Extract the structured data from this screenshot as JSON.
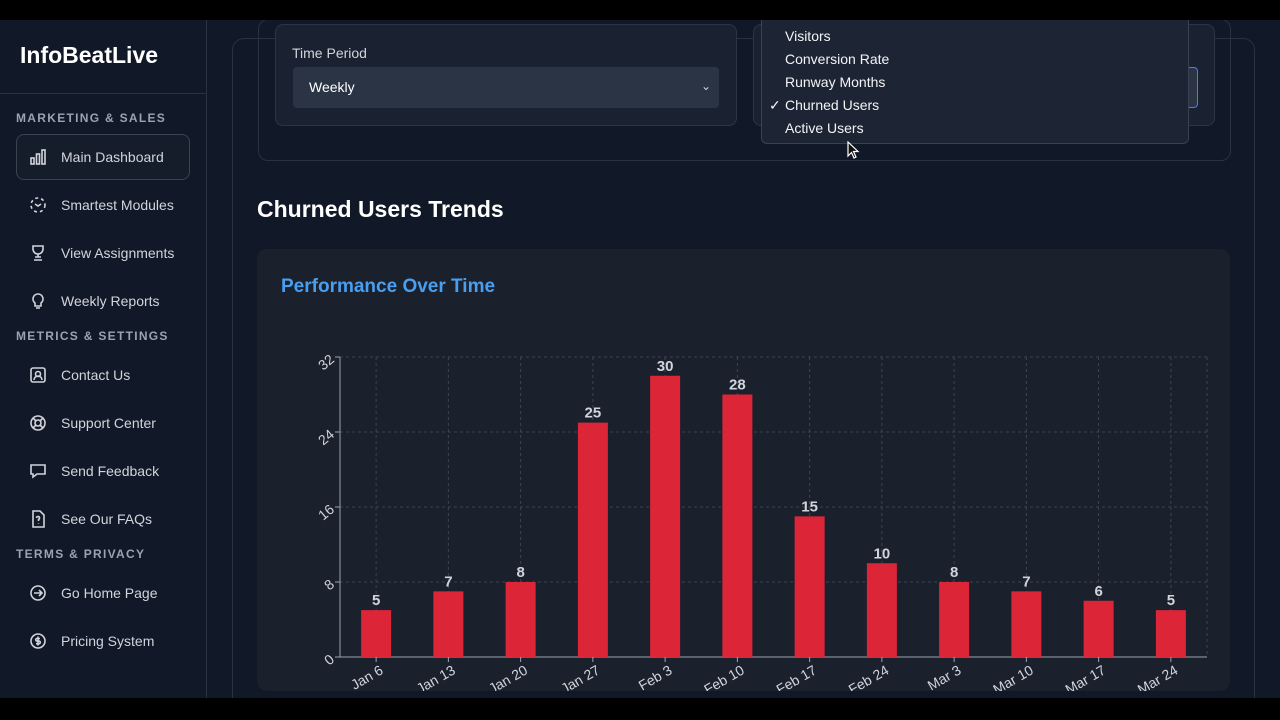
{
  "app": {
    "title": "InfoBeatLive"
  },
  "sidebar": {
    "sections": [
      {
        "title": "MARKETING & SALES",
        "items": [
          {
            "label": "Main Dashboard",
            "icon": "bar-chart-icon",
            "active": true
          },
          {
            "label": "Smartest Modules",
            "icon": "modules-icon"
          },
          {
            "label": "View Assignments",
            "icon": "trophy-icon"
          },
          {
            "label": "Weekly Reports",
            "icon": "lightbulb-icon"
          }
        ]
      },
      {
        "title": "METRICS & SETTINGS",
        "items": [
          {
            "label": "Contact Us",
            "icon": "contact-icon"
          },
          {
            "label": "Support Center",
            "icon": "lifebuoy-icon"
          },
          {
            "label": "Send Feedback",
            "icon": "chat-icon"
          },
          {
            "label": "See Our FAQs",
            "icon": "faq-icon"
          }
        ]
      },
      {
        "title": "TERMS & PRIVACY",
        "items": [
          {
            "label": "Go Home Page",
            "icon": "arrow-circle-icon"
          },
          {
            "label": "Pricing System",
            "icon": "dollar-icon"
          }
        ]
      }
    ]
  },
  "filters": {
    "time_period": {
      "label": "Time Period",
      "value": "Weekly"
    },
    "metric_menu": {
      "options": [
        "Visitors",
        "Conversion Rate",
        "Runway Months",
        "Churned Users",
        "Active Users"
      ],
      "selected": "Churned Users"
    }
  },
  "main": {
    "heading": "Churned Users Trends",
    "chart_title": "Performance Over Time"
  },
  "colors": {
    "bar": "#dc2638",
    "title": "#4a9eef"
  },
  "chart_data": {
    "type": "bar",
    "title": "Performance Over Time",
    "categories": [
      "Jan 6",
      "Jan 13",
      "Jan 20",
      "Jan 27",
      "Feb 3",
      "Feb 10",
      "Feb 17",
      "Feb 24",
      "Mar 3",
      "Mar 10",
      "Mar 17",
      "Mar 24"
    ],
    "values": [
      5,
      7,
      8,
      25,
      30,
      28,
      15,
      10,
      8,
      7,
      6,
      5
    ],
    "ylim": [
      0,
      32
    ],
    "yticks": [
      0,
      8,
      16,
      24,
      32
    ],
    "grid": true,
    "data_labels": true
  }
}
